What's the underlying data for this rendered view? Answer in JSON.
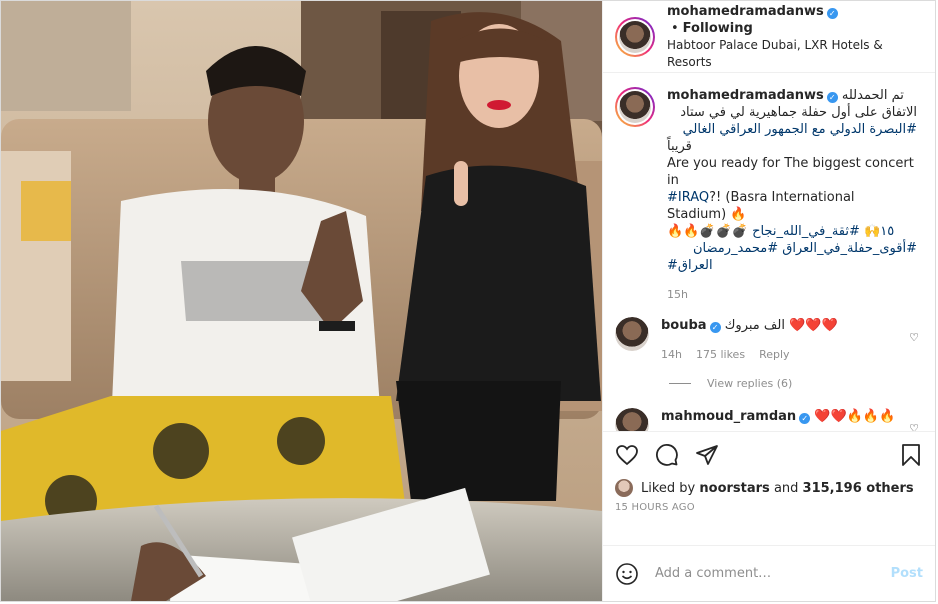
{
  "header": {
    "username": "mohamedramadanws",
    "separator": "•",
    "follow_label": "Following",
    "location": "Habtoor Palace Dubai, LXR Hotels & Resorts"
  },
  "caption": {
    "username": "mohamedramadanws",
    "line1": "تم الحمدلله",
    "line2": "الاتفاق على أول حفلة جماهيرية لي في ستاد",
    "line3": "#البصرة الدولي مع الجمهور العراقي الغالي",
    "line4": "قريباً",
    "line5": "Are you ready for The biggest concert in",
    "line6_tag": "#IRAQ",
    "line6_rest": "?! (Basra International Stadium) 🔥",
    "line7": "🔥🔥💣💣💣 ١٥🙌 #ثقة_في_الله_نجاح",
    "line8": "#أقوى_حفلة_في_العراق #محمد_رمضان",
    "line9": "#العراق",
    "time": "15h"
  },
  "comments": [
    {
      "username": "bouba",
      "text": "الف مبروك ❤️❤️❤️",
      "time": "14h",
      "likes": "175 likes",
      "reply": "Reply",
      "view_replies": "View replies (6)"
    },
    {
      "username": "mahmoud_ramdan",
      "text": "❤️❤️🔥🔥🔥"
    }
  ],
  "likes_line": {
    "prefix": "Liked by",
    "user": "noorstars",
    "joiner": "and",
    "count": "315,196 others"
  },
  "time_ago": "15 HOURS AGO",
  "add_comment": {
    "placeholder": "Add a comment…",
    "post_label": "Post"
  },
  "colors": {
    "verified": "#3897f0",
    "hashtag": "#00376b",
    "post_disabled": "#b2dffc",
    "muted": "#8e8e8e"
  },
  "icons": [
    "heart-icon",
    "comment-icon",
    "share-icon",
    "bookmark-icon",
    "emoji-icon",
    "verified-icon"
  ]
}
